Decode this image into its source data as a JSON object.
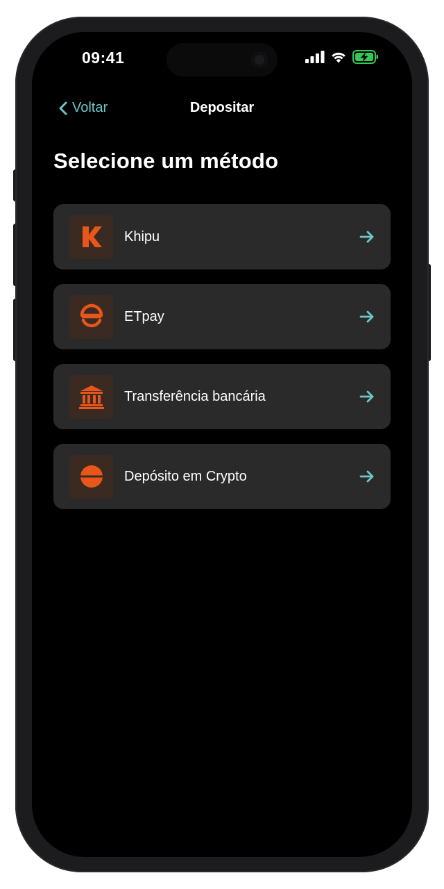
{
  "status_bar": {
    "time": "09:41"
  },
  "nav": {
    "back_label": "Voltar",
    "title": "Depositar"
  },
  "page": {
    "title": "Selecione um método"
  },
  "methods": [
    {
      "label": "Khipu",
      "icon": "khipu-logo-icon"
    },
    {
      "label": "ETpay",
      "icon": "etpay-logo-icon"
    },
    {
      "label": "Transferência bancária",
      "icon": "bank-icon"
    },
    {
      "label": "Depósito em Crypto",
      "icon": "crypto-icon"
    }
  ],
  "colors": {
    "accent": "#6fc7c9",
    "icon_orange": "#e8561a",
    "card_bg": "#2a2a2b",
    "icon_tile_bg": "#3a2a22",
    "battery_green": "#34c759"
  }
}
